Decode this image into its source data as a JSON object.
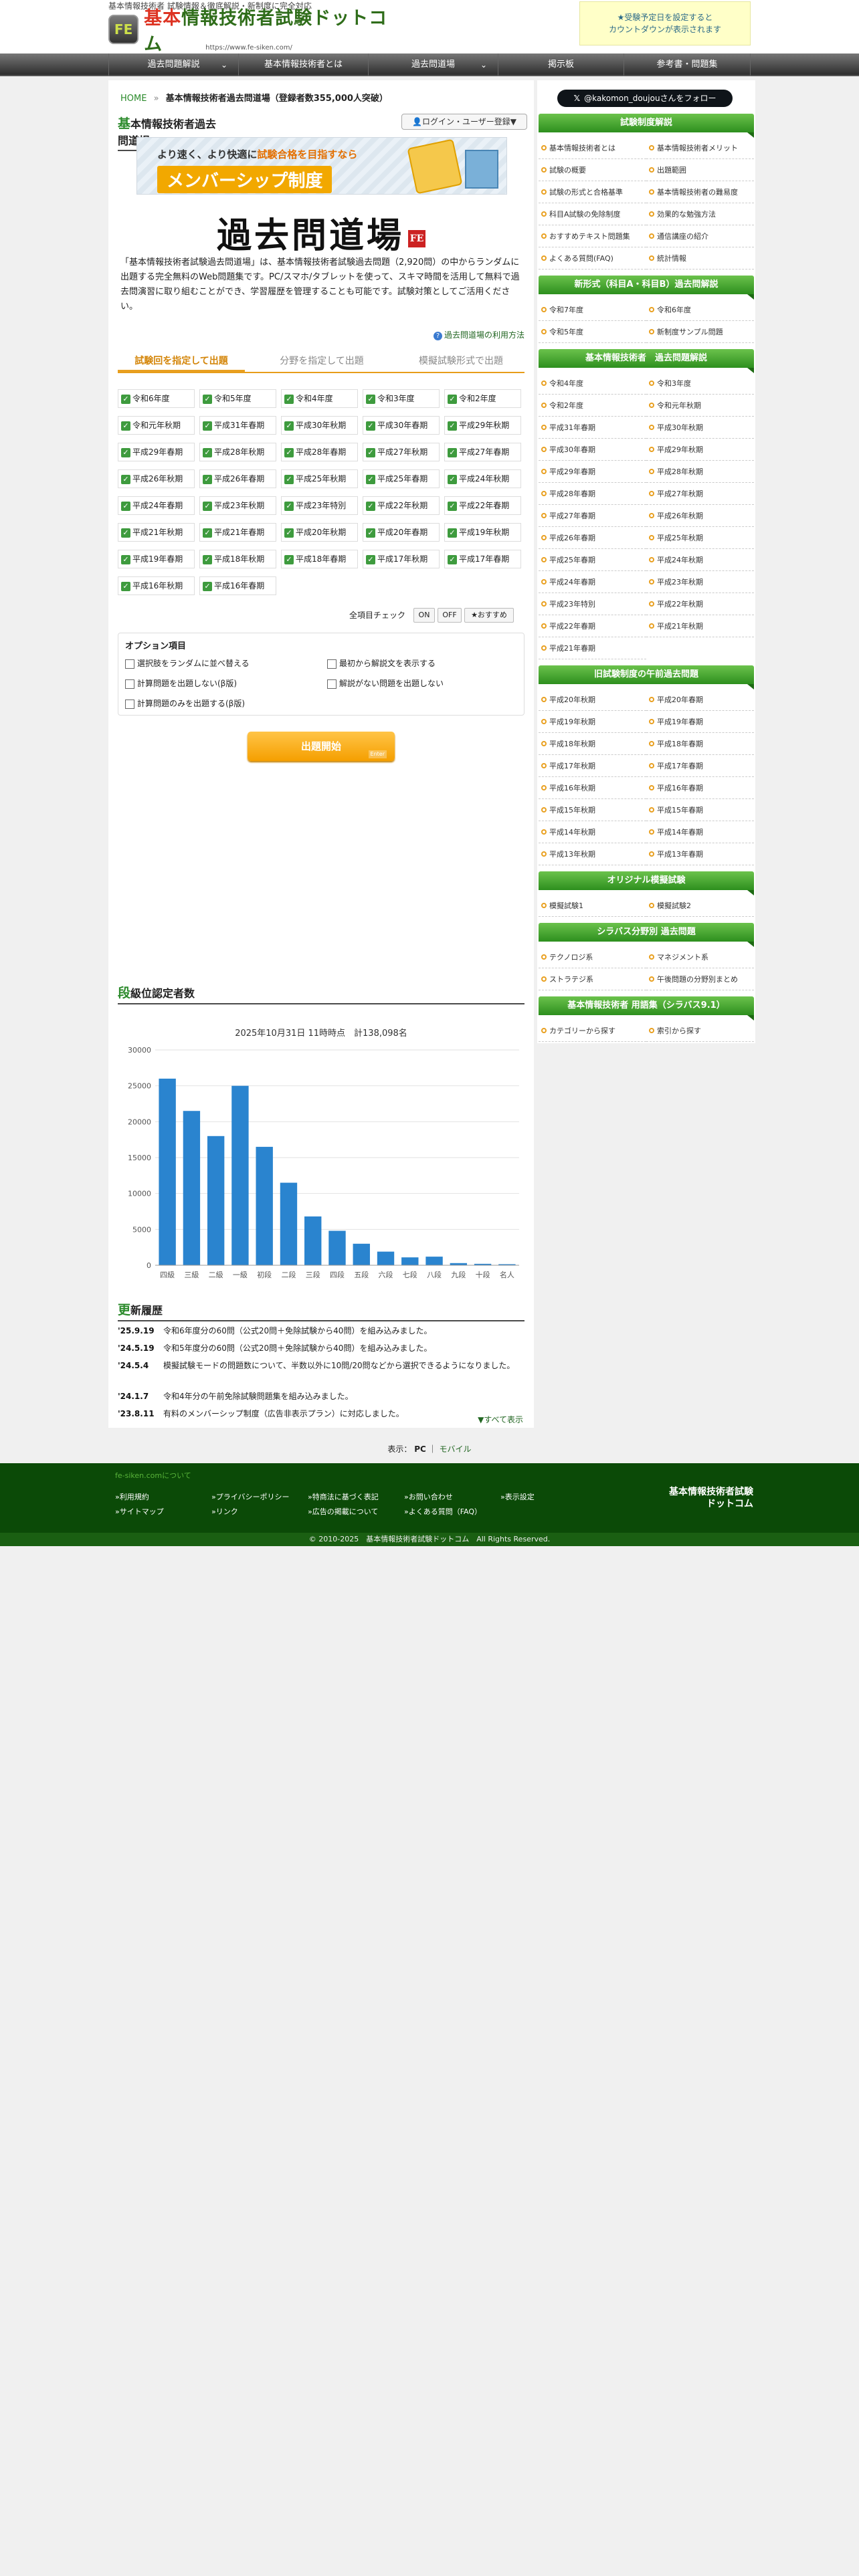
{
  "header": {
    "tagline": "基本情報技術者 試験情報＆徹底解説・新制度に完全対応",
    "logo_badge": "FE",
    "logo_red": "基本",
    "logo_text": "情報技術者試験ドットコム",
    "url": "https://www.fe-siken.com/",
    "countdown": "★受験予定日を設定すると\nカウントダウンが表示されます"
  },
  "nav": [
    "過去問題解説",
    "基本情報技術者とは",
    "過去問道場",
    "掲示板",
    "参考書・問題集"
  ],
  "breadcrumb": {
    "home": "HOME",
    "sep": "»",
    "current": "基本情報技術者過去問道場（登録者数355,000人突破）"
  },
  "page_title": {
    "initial": "基",
    "rest": "本情報技術者過去問道場"
  },
  "login_button": "ログイン・ユーザー登録▼",
  "banner": {
    "line1a": "より速く、より快適に",
    "line1b": "試験合格を目指すなら",
    "line2": "メンバーシップ制度"
  },
  "dojo_title": "過去問道場",
  "dojo_stamp": "FE",
  "intro": "「基本情報技術者試験過去問道場」は、基本情報技術者試験過去問題（2,920問）の中からランダムに出題する完全無料のWeb問題集です。PC/スマホ/タブレットを使って、スキマ時間を活用して無料で過去問演習に取り組むことができ、学習履歴を管理することも可能です。試験対策としてご活用ください。",
  "howto_link": "過去問道場の利用方法",
  "tabs": [
    "試験回を指定して出題",
    "分野を指定して出題",
    "模擬試験形式で出題"
  ],
  "exams": [
    "令和6年度",
    "令和5年度",
    "令和4年度",
    "令和3年度",
    "令和2年度",
    "令和元年秋期",
    "平成31年春期",
    "平成30年秋期",
    "平成30年春期",
    "平成29年秋期",
    "平成29年春期",
    "平成28年秋期",
    "平成28年春期",
    "平成27年秋期",
    "平成27年春期",
    "平成26年秋期",
    "平成26年春期",
    "平成25年秋期",
    "平成25年春期",
    "平成24年秋期",
    "平成24年春期",
    "平成23年秋期",
    "平成23年特別",
    "平成22年秋期",
    "平成22年春期",
    "平成21年秋期",
    "平成21年春期",
    "平成20年秋期",
    "平成20年春期",
    "平成19年秋期",
    "平成19年春期",
    "平成18年秋期",
    "平成18年春期",
    "平成17年秋期",
    "平成17年春期",
    "平成16年秋期",
    "平成16年春期"
  ],
  "all_check": {
    "label": "全項目チェック",
    "on": "ON",
    "off": "OFF",
    "recommend": "★おすすめ"
  },
  "options": {
    "title": "オプション項目",
    "items": [
      "選択肢をランダムに並べ替える",
      "最初から解説文を表示する",
      "計算問題を出題しない(β版)",
      "解説がない問題を出題しない",
      "計算問題のみを出題する(β版)"
    ]
  },
  "start_button": {
    "label": "出題開始",
    "sub": "Enter"
  },
  "rank_title": {
    "initial": "段",
    "rest": "級位認定者数"
  },
  "chart_data": {
    "type": "bar",
    "title": "2025年10月31日 11時時点　計138,098名",
    "categories": [
      "四級",
      "三級",
      "二級",
      "一級",
      "初段",
      "二段",
      "三段",
      "四段",
      "五段",
      "六段",
      "七段",
      "八段",
      "九段",
      "十段",
      "名人"
    ],
    "values": [
      26000,
      21500,
      18000,
      25000,
      16500,
      11500,
      6800,
      4800,
      3000,
      1900,
      1100,
      1200,
      300,
      200,
      150
    ],
    "ylim": [
      0,
      30000
    ],
    "yticks": [
      0,
      5000,
      10000,
      15000,
      20000,
      25000,
      30000
    ],
    "grid": true,
    "color": "#2a84cf"
  },
  "update_title": {
    "initial": "更",
    "rest": "新履歴"
  },
  "history": [
    {
      "date": "'25.9.19",
      "text": "令和6年度分の60問（公式20問＋免除試験から40問）を組み込みました。"
    },
    {
      "date": "'24.5.19",
      "text": "令和5年度分の60問（公式20問＋免除試験から40問）を組み込みました。"
    },
    {
      "date": "'24.5.4",
      "text": "模擬試験モードの問題数について、半数以外に10問/20問などから選択できるようになりました。"
    },
    {
      "date": "'24.1.7",
      "text": "令和4年分の午前免除試験問題集を組み込みました。"
    },
    {
      "date": "'23.8.11",
      "text": "有料のメンバーシップ制度（広告非表示プラン）に対応しました。"
    }
  ],
  "show_all": "▼すべて表示",
  "display_mode": {
    "label": "表示：",
    "pc": "PC",
    "sep": "｜",
    "mobile": "モバイル"
  },
  "sidebar": {
    "follow": "@kakomon_doujouさんをフォロー",
    "sections": [
      {
        "title": "試験制度解説",
        "items": [
          "基本情報技術者とは",
          "基本情報技術者メリット",
          "試験の概要",
          "出題範囲",
          "試験の形式と合格基準",
          "基本情報技術者の難易度",
          "科目A試験の免除制度",
          "効果的な勉強方法",
          "おすすめテキスト問題集",
          "通信講座の紹介",
          "よくある質問(FAQ)",
          "統計情報"
        ]
      },
      {
        "title": "新形式（科目A・科目B）過去問解説",
        "items": [
          "令和7年度",
          "令和6年度",
          "令和5年度",
          "新制度サンプル問題"
        ]
      },
      {
        "title": "基本情報技術者　過去問題解説",
        "items": [
          "令和4年度",
          "令和3年度",
          "令和2年度",
          "令和元年秋期",
          "平成31年春期",
          "平成30年秋期",
          "平成30年春期",
          "平成29年秋期",
          "平成29年春期",
          "平成28年秋期",
          "平成28年春期",
          "平成27年秋期",
          "平成27年春期",
          "平成26年秋期",
          "平成26年春期",
          "平成25年秋期",
          "平成25年春期",
          "平成24年秋期",
          "平成24年春期",
          "平成23年秋期",
          "平成23年特別",
          "平成22年秋期",
          "平成22年春期",
          "平成21年秋期",
          "平成21年春期"
        ]
      },
      {
        "title": "旧試験制度の午前過去問題",
        "items": [
          "平成20年秋期",
          "平成20年春期",
          "平成19年秋期",
          "平成19年春期",
          "平成18年秋期",
          "平成18年春期",
          "平成17年秋期",
          "平成17年春期",
          "平成16年秋期",
          "平成16年春期",
          "平成15年秋期",
          "平成15年春期",
          "平成14年秋期",
          "平成14年春期",
          "平成13年秋期",
          "平成13年春期"
        ]
      },
      {
        "title": "オリジナル模擬試験",
        "items": [
          "模擬試験1",
          "模擬試験2"
        ]
      },
      {
        "title": "シラバス分野別 過去問題",
        "items": [
          "テクノロジ系",
          "マネジメント系",
          "ストラテジ系",
          "午後問題の分野別まとめ"
        ]
      },
      {
        "title": "基本情報技術者 用語集（シラバス9.1）",
        "items": [
          "カテゴリーから探す",
          "索引から探す"
        ]
      }
    ]
  },
  "footer": {
    "title": "fe-siken.comについて",
    "links": [
      "»利用規約",
      "»プライバシーポリシー",
      "»特商法に基づく表記",
      "»お問い合わせ",
      "»表示設定",
      "»サイトマップ",
      "»リンク",
      "»広告の掲載について",
      "»よくある質問（FAQ）"
    ],
    "logo_line1": "基本情報技術者試験",
    "logo_line2": "ドットコム",
    "copyright": "© 2010-2025　基本情報技術者試験ドットコム　All Rights Reserved."
  }
}
